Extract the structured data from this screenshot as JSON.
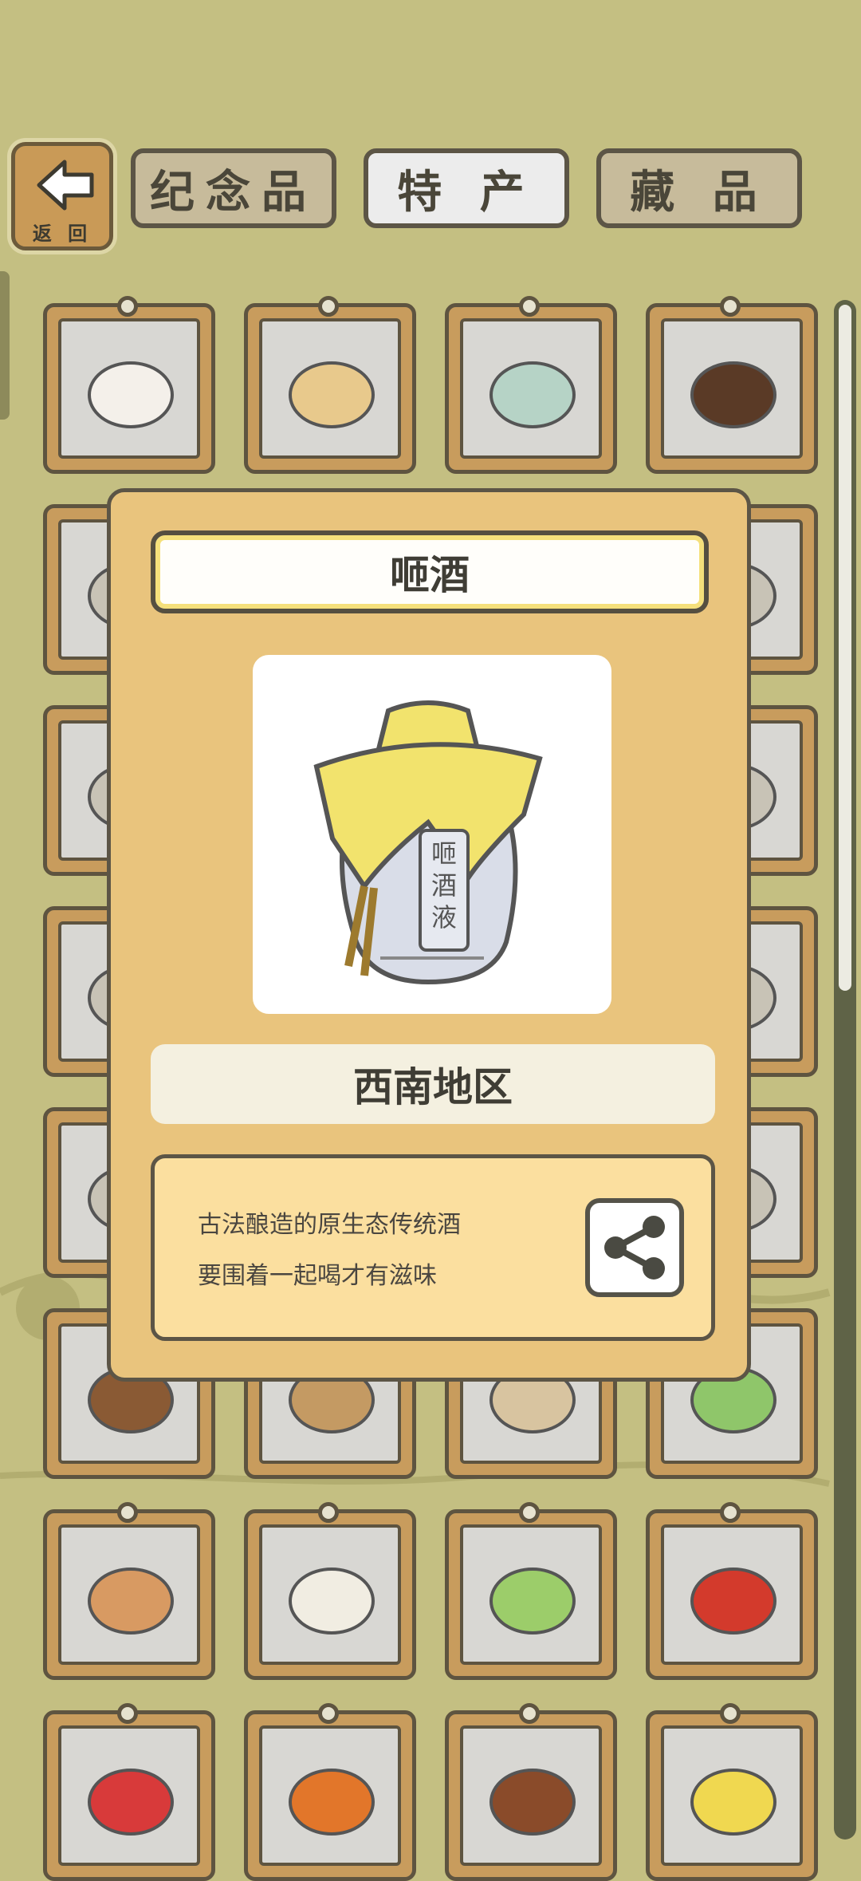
{
  "header": {
    "back_label": "返 回",
    "tabs": [
      {
        "label": "纪念品",
        "active": false
      },
      {
        "label": "特 产",
        "active": true
      },
      {
        "label": "藏 品",
        "active": false
      }
    ]
  },
  "modal": {
    "title": "咂酒",
    "image_icon": "liquor-bottle-icon",
    "region": "西南地区",
    "description_lines": [
      "古法酿造的原生态传统酒",
      "要围着一起喝才有滋味"
    ],
    "share_icon": "share-icon"
  },
  "grid": {
    "rows": [
      [
        "porridge-bowl-icon",
        "tofu-plate-icon",
        "tea-jar-icon",
        "coffee-beans-icon"
      ],
      [
        "item-icon",
        "item-icon",
        "item-icon",
        "item-icon"
      ],
      [
        "item-icon",
        "item-icon",
        "item-icon",
        "item-icon"
      ],
      [
        "item-icon",
        "item-icon",
        "item-icon",
        "item-icon"
      ],
      [
        "item-icon",
        "item-icon",
        "item-icon",
        "item-icon"
      ],
      [
        "chestnut-bowl-icon",
        "peanuts-icon",
        "rice-sack-icon",
        "cabbage-icon"
      ],
      [
        "onion-icon",
        "garlic-icon",
        "scallion-icon",
        "chili-peppers-icon"
      ],
      [
        "strawberry-icon",
        "persimmon-icon",
        "chestnuts-icon",
        "banana-icon"
      ]
    ]
  },
  "colors": {
    "background": "#c4bf82",
    "modal": "#e9c47d",
    "card_frame": "#c89c5d",
    "card_inner": "#d8d7d3",
    "outline": "#5e5440"
  }
}
